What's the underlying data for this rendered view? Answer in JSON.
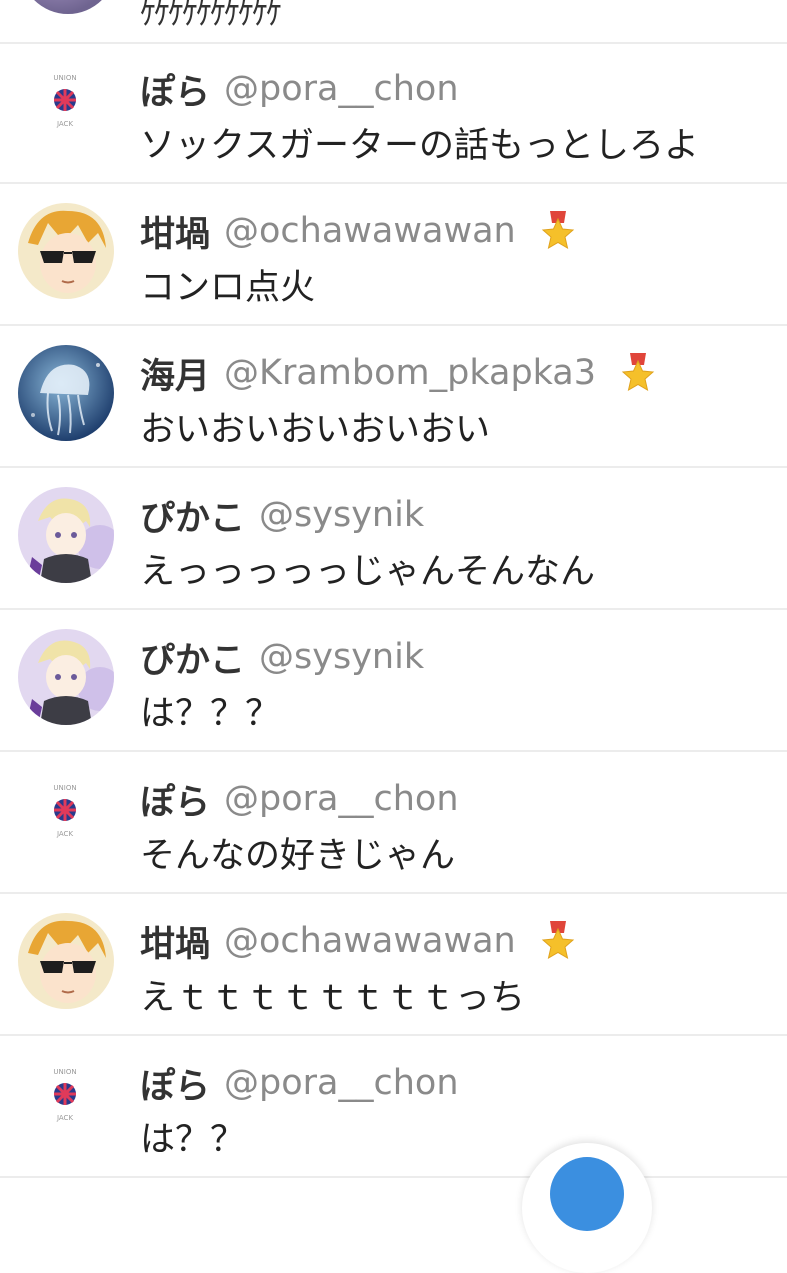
{
  "top_partial_message": "ｹｹｹｹｹｹｹｹｹｹ",
  "messages": [
    {
      "name": "ぽら",
      "handle": "@pora__chon",
      "text": "ソックスガーターの話もっとしろよ",
      "avatar": "logo",
      "badge": false
    },
    {
      "name": "坩堝",
      "handle": "@ochawawawan",
      "text": "コンロ点火",
      "avatar": "sunglasses",
      "badge": true
    },
    {
      "name": "海月",
      "handle": "@Krambom_pkapka3",
      "text": "おいおいおいおいおい",
      "avatar": "jellyfish",
      "badge": true
    },
    {
      "name": "ぴかこ",
      "handle": "@sysynik",
      "text": "えっっっっっじゃんそんなん",
      "avatar": "purple",
      "badge": false
    },
    {
      "name": "ぴかこ",
      "handle": "@sysynik",
      "text": "は？？？",
      "avatar": "purple",
      "badge": false
    },
    {
      "name": "ぽら",
      "handle": "@pora__chon",
      "text": "そんなの好きじゃん",
      "avatar": "logo",
      "badge": false
    },
    {
      "name": "坩堝",
      "handle": "@ochawawawan",
      "text": "えｔｔｔｔｔｔｔｔっち",
      "avatar": "sunglasses",
      "badge": true
    },
    {
      "name": "ぽら",
      "handle": "@pora__chon",
      "text": "は？？",
      "avatar": "logo",
      "badge": false
    }
  ],
  "colors": {
    "accent": "#3b8fe0",
    "handle": "#8a8a8a",
    "divider": "#ececec",
    "badge_ribbon": "#e0453a",
    "badge_star": "#f5c02a"
  },
  "icons": {
    "badge": "star-medal-icon",
    "fab": "compose-button"
  }
}
